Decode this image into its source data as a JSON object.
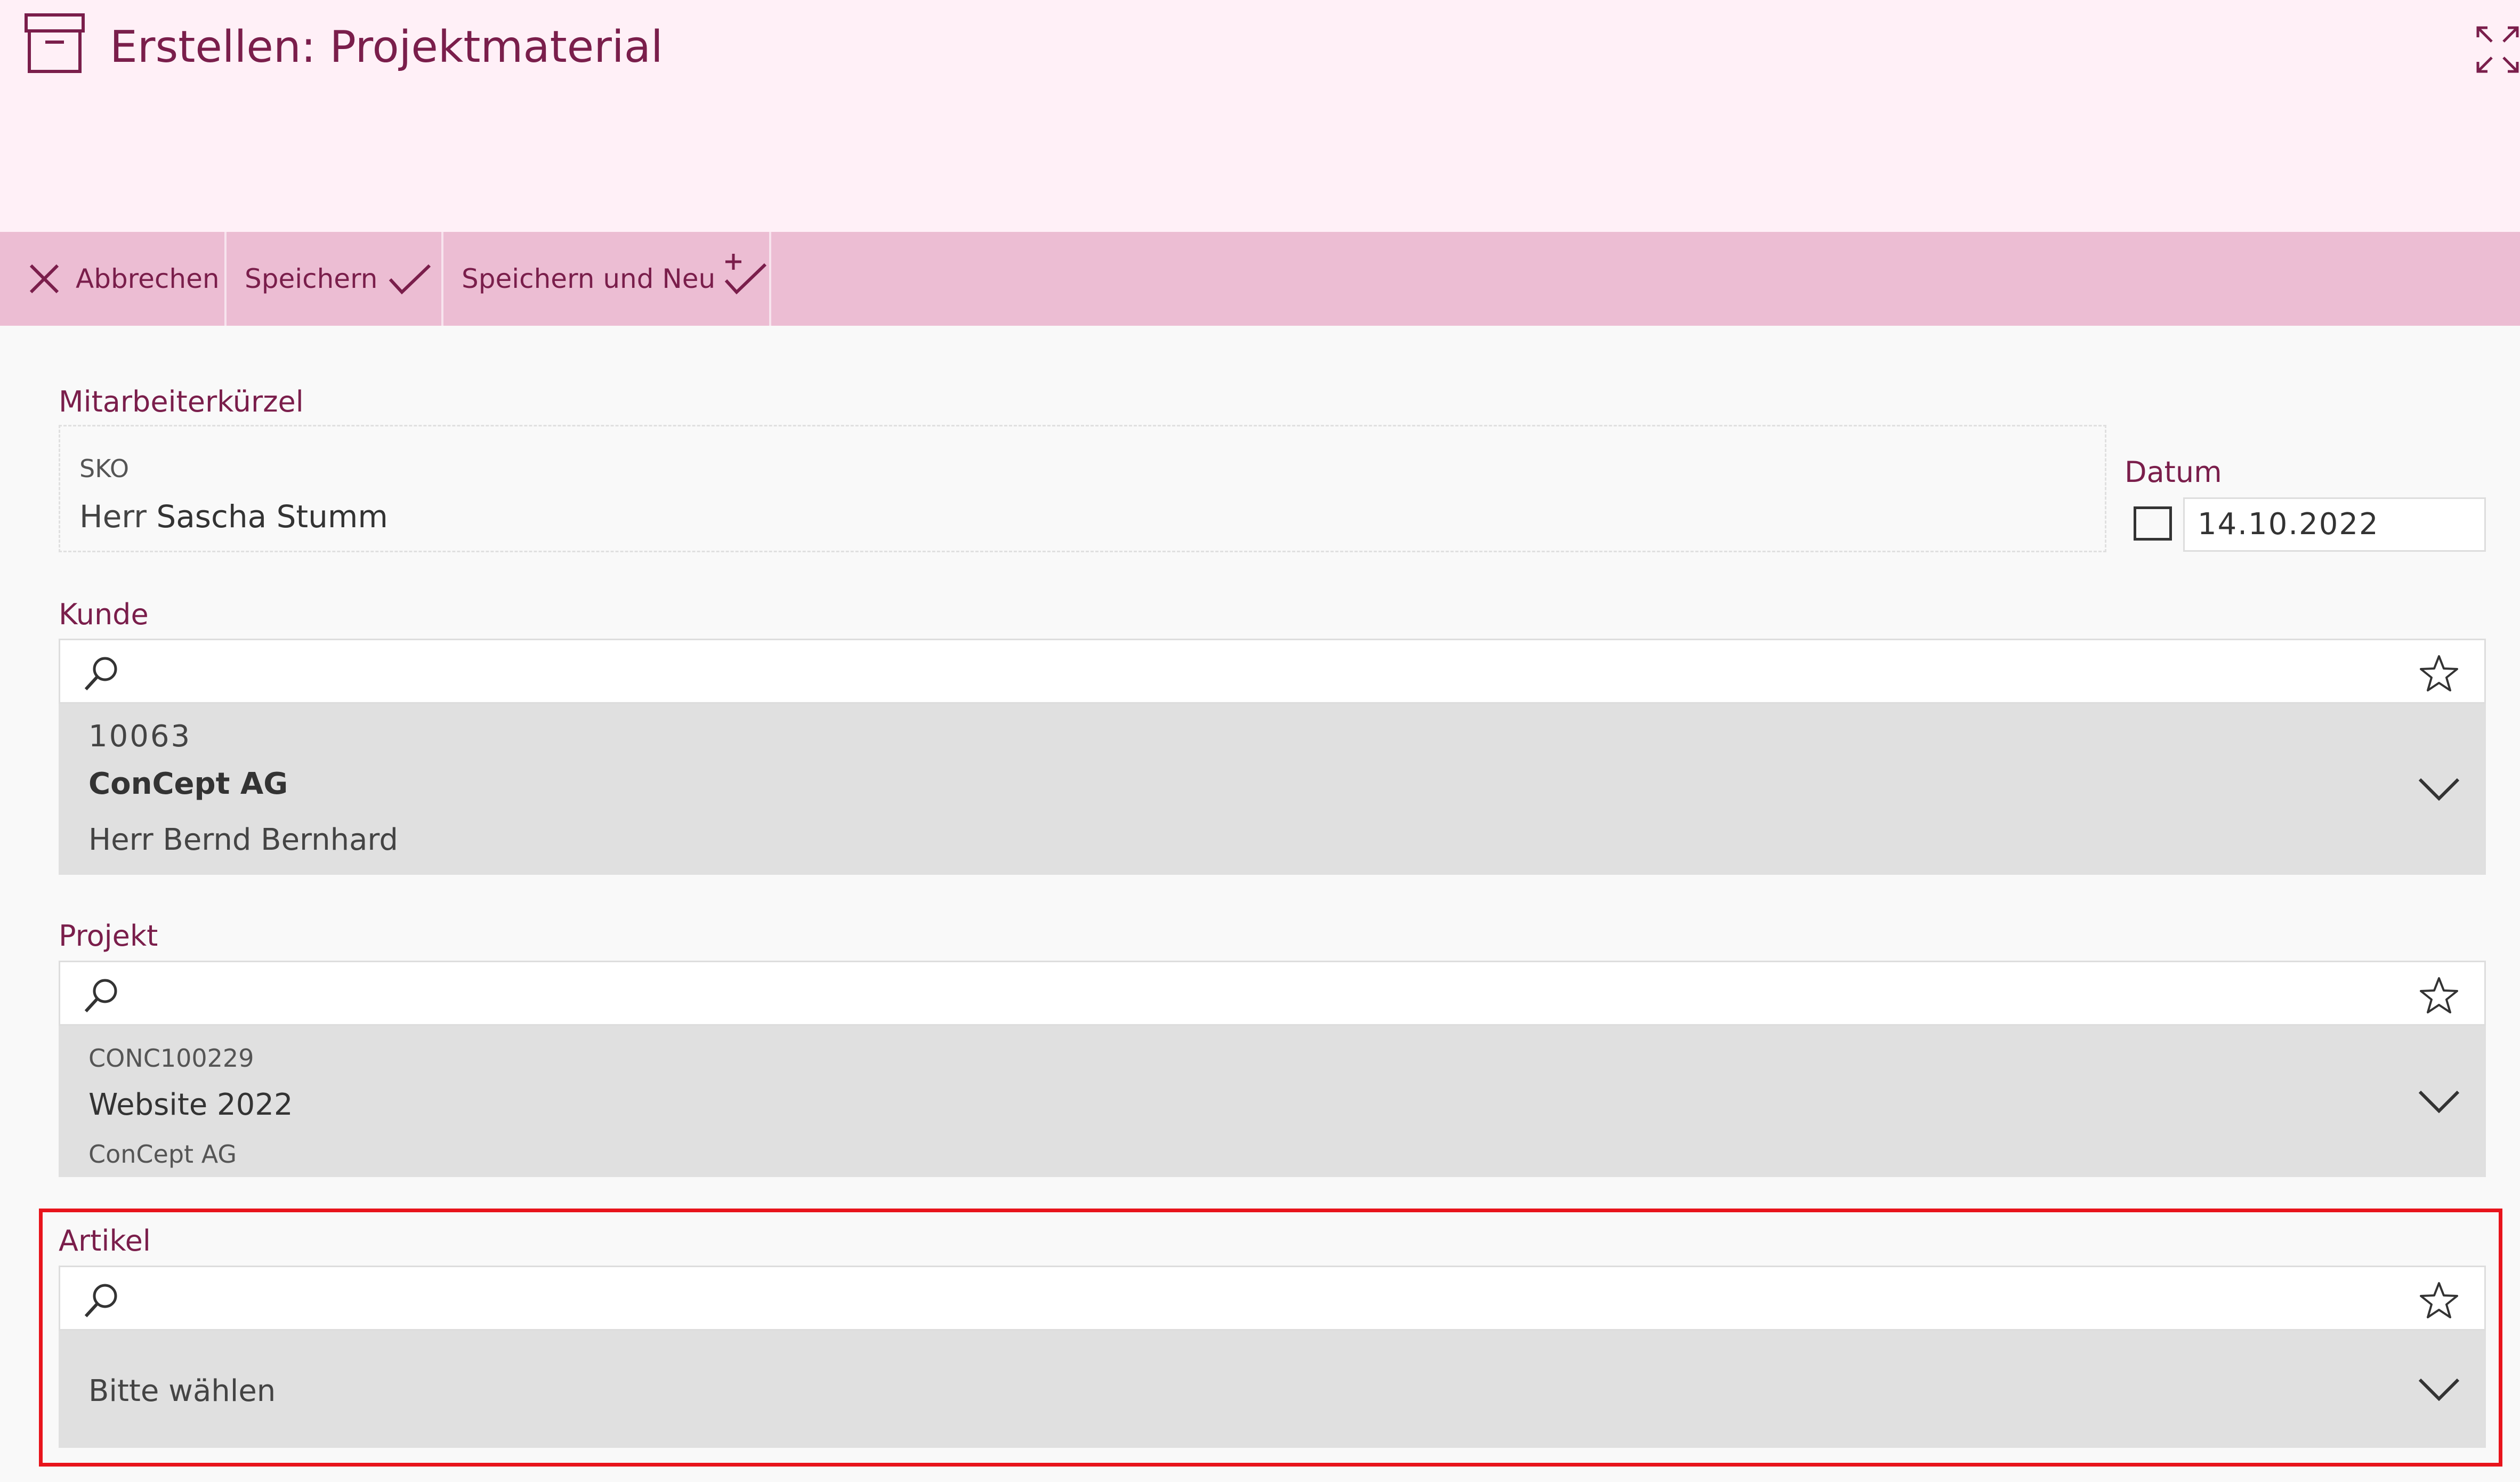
{
  "header": {
    "title": "Erstellen: Projektmaterial",
    "icon": "archive-box-icon",
    "expand_icon": "expand-icon"
  },
  "toolbar": {
    "cancel_label": "Abbrechen",
    "save_label": "Speichern",
    "save_new_label": "Speichern und Neu"
  },
  "form": {
    "employee": {
      "label": "Mitarbeiterkürzel",
      "code": "SKO",
      "salutation": "Herr",
      "name": "Sascha Stumm"
    },
    "date": {
      "label": "Datum",
      "value": "14.10.2022"
    },
    "customer": {
      "label": "Kunde",
      "search_value": "",
      "number": "10063",
      "name": "ConCept AG",
      "contact": "Herr Bernd Bernhard"
    },
    "project": {
      "label": "Projekt",
      "search_value": "",
      "code": "CONC100229",
      "name": "Website 2022",
      "customer": "ConCept AG"
    },
    "article": {
      "label": "Artikel",
      "search_value": "",
      "placeholder": "Bitte wählen"
    }
  },
  "colors": {
    "accent": "#7a1e4b",
    "header_bg": "#fff0f7",
    "toolbar_bg": "#ecbdd3",
    "highlight": "#e8141c"
  }
}
